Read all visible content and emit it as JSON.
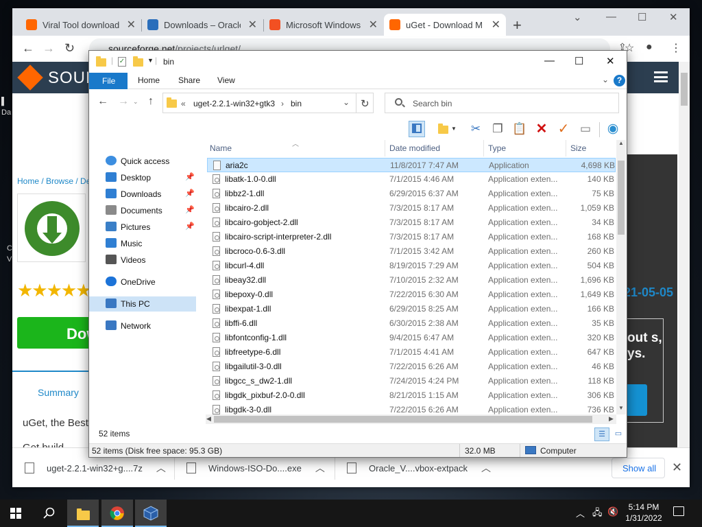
{
  "browser": {
    "tabs": [
      {
        "title": "Viral Tool download | S",
        "color": "#ff6600"
      },
      {
        "title": "Downloads – Oracle VM",
        "color": "#2a6ebb"
      },
      {
        "title": "Microsoft Windows and",
        "color": "#f25022"
      },
      {
        "title": "uGet - Download Manager",
        "color": "#ff6600",
        "active": true
      }
    ],
    "new_tab_label": "+",
    "url_domain": "sourceforge.net",
    "url_path": "/projects/urlget/",
    "window_controls": [
      "⌄",
      "—",
      "☐",
      "✕"
    ]
  },
  "page": {
    "logo_text": "SOUR",
    "breadcrumb": "Home / Browse / De",
    "rating_stars": "★★★★★",
    "download_label": "Dow",
    "summary_tab": "Summary",
    "desc_1": "uGet, the Best",
    "desc_2": "Get build",
    "date_fragment": "21-05-05",
    "ad_text": "out s, ys."
  },
  "desktop_fragments": [
    "Da",
    "C",
    "V"
  ],
  "downloads_shelf": {
    "items": [
      {
        "name": "uget-2.2.1-win32+g....7z"
      },
      {
        "name": "Windows-ISO-Do....exe"
      },
      {
        "name": "Oracle_V....vbox-extpack"
      }
    ],
    "show_all": "Show all",
    "close": "✕"
  },
  "explorer": {
    "title": "bin",
    "ribbon_tabs": [
      "File",
      "Home",
      "Share",
      "View"
    ],
    "help": "?",
    "address": {
      "prefix": "«",
      "parts": [
        "uget-2.2.1-win32+gtk3",
        "bin"
      ]
    },
    "search_placeholder": "Search bin",
    "nav_items": [
      {
        "label": "Quick access",
        "icon": "star-icon",
        "color": "#3c8ee0"
      },
      {
        "label": "Desktop",
        "icon": "desktop-icon",
        "color": "#2f7fd3",
        "pinned": true
      },
      {
        "label": "Downloads",
        "icon": "downloads-icon",
        "color": "#2f7fd3",
        "pinned": true
      },
      {
        "label": "Documents",
        "icon": "documents-icon",
        "color": "#8a8a8a",
        "pinned": true
      },
      {
        "label": "Pictures",
        "icon": "pictures-icon",
        "color": "#3a7fc7",
        "pinned": true
      },
      {
        "label": "Music",
        "icon": "music-icon",
        "color": "#2f7fd3"
      },
      {
        "label": "Videos",
        "icon": "videos-icon",
        "color": "#555555"
      },
      {
        "label": "OneDrive",
        "icon": "cloud-icon",
        "color": "#1c73d8"
      },
      {
        "label": "This PC",
        "icon": "computer-icon",
        "color": "#3a78c2",
        "selected": true
      },
      {
        "label": "Network",
        "icon": "network-icon",
        "color": "#3a78c2"
      }
    ],
    "columns": [
      "Name",
      "Date modified",
      "Type",
      "Size"
    ],
    "files": [
      {
        "name": "aria2c",
        "date": "11/8/2017 7:47 AM",
        "type": "Application",
        "size": "4,698 KB",
        "selected": true
      },
      {
        "name": "libatk-1.0-0.dll",
        "date": "7/1/2015 4:46 AM",
        "type": "Application exten...",
        "size": "140 KB"
      },
      {
        "name": "libbz2-1.dll",
        "date": "6/29/2015 6:37 AM",
        "type": "Application exten...",
        "size": "75 KB"
      },
      {
        "name": "libcairo-2.dll",
        "date": "7/3/2015 8:17 AM",
        "type": "Application exten...",
        "size": "1,059 KB"
      },
      {
        "name": "libcairo-gobject-2.dll",
        "date": "7/3/2015 8:17 AM",
        "type": "Application exten...",
        "size": "34 KB"
      },
      {
        "name": "libcairo-script-interpreter-2.dll",
        "date": "7/3/2015 8:17 AM",
        "type": "Application exten...",
        "size": "168 KB"
      },
      {
        "name": "libcroco-0.6-3.dll",
        "date": "7/1/2015 3:42 AM",
        "type": "Application exten...",
        "size": "260 KB"
      },
      {
        "name": "libcurl-4.dll",
        "date": "8/19/2015 7:29 AM",
        "type": "Application exten...",
        "size": "504 KB"
      },
      {
        "name": "libeay32.dll",
        "date": "7/10/2015 2:32 AM",
        "type": "Application exten...",
        "size": "1,696 KB"
      },
      {
        "name": "libepoxy-0.dll",
        "date": "7/22/2015 6:30 AM",
        "type": "Application exten...",
        "size": "1,649 KB"
      },
      {
        "name": "libexpat-1.dll",
        "date": "6/29/2015 8:25 AM",
        "type": "Application exten...",
        "size": "166 KB"
      },
      {
        "name": "libffi-6.dll",
        "date": "6/30/2015 2:38 AM",
        "type": "Application exten...",
        "size": "35 KB"
      },
      {
        "name": "libfontconfig-1.dll",
        "date": "9/4/2015 6:47 AM",
        "type": "Application exten...",
        "size": "320 KB"
      },
      {
        "name": "libfreetype-6.dll",
        "date": "7/1/2015 4:41 AM",
        "type": "Application exten...",
        "size": "647 KB"
      },
      {
        "name": "libgailutil-3-0.dll",
        "date": "7/22/2015 6:26 AM",
        "type": "Application exten...",
        "size": "46 KB"
      },
      {
        "name": "libgcc_s_dw2-1.dll",
        "date": "7/24/2015 4:24 PM",
        "type": "Application exten...",
        "size": "118 KB"
      },
      {
        "name": "libgdk_pixbuf-2.0-0.dll",
        "date": "8/21/2015 1:15 AM",
        "type": "Application exten...",
        "size": "306 KB"
      },
      {
        "name": "libgdk-3-0.dll",
        "date": "7/22/2015 6:26 AM",
        "type": "Application exten...",
        "size": "736 KB"
      }
    ],
    "item_count": "52 items",
    "status_left": "52 items (Disk free space: 95.3 GB)",
    "status_size": "32.0 MB",
    "status_location": "Computer"
  },
  "taskbar": {
    "time": "5:14 PM",
    "date": "1/31/2022"
  }
}
